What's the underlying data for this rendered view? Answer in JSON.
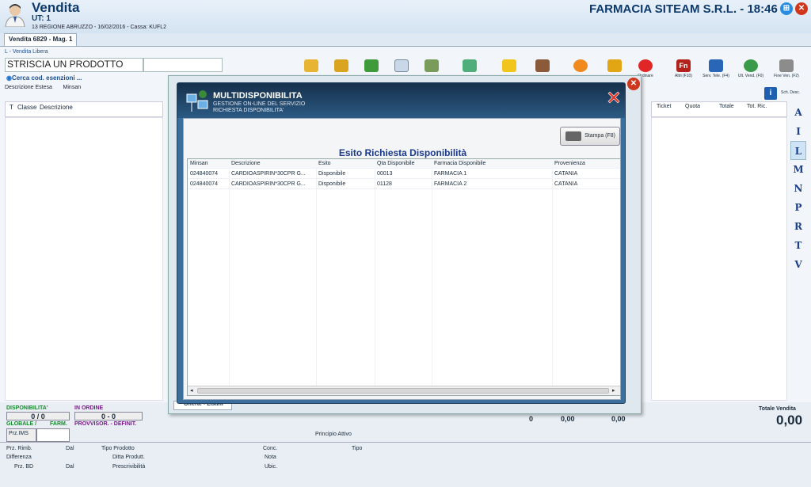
{
  "header": {
    "title": "Vendita",
    "user": "UT: 1",
    "info": "13 REGIONE ABRUZZO - 16/02/2016 - Cassa: KUFL2",
    "company": "FARMACIA SITEAM S.R.L. - 18:46"
  },
  "tab": {
    "label": "Vendita 6829 - Mag. 1"
  },
  "sale": {
    "type": "L - Vendita Libera",
    "product_placeholder": "STRISCIA UN PRODOTTO",
    "cerca": "Cerca cod. esenzioni ...",
    "col1": "Descrizione Estesa",
    "col2": "Minsan"
  },
  "table_headers": [
    "T",
    "Classe",
    "Descrizione"
  ],
  "right_headers": [
    "Ticket",
    "Quota",
    "Totale",
    "Tot. Ric."
  ],
  "toolbar": {
    "ordinare": "Ordinare",
    "altri": "Altri (F10)",
    "serv_tele": "Serv. Tele. (F4)",
    "ult_vend": "Ult. Vend. (F0)",
    "fine_ven": "Fine Ven. (F2)",
    "sch_desc": "Sch. Desc."
  },
  "letters": [
    "A",
    "I",
    "L",
    "M",
    "N",
    "P",
    "R",
    "T",
    "V"
  ],
  "dialog": {
    "title": "MULTIDISPONIBILITA",
    "sub1": "GESTIONE ON-LINE DEL SERVIZIO",
    "sub2": "RICHIESTA DISPONIBILITA'",
    "stampa": "Stampa (F8)",
    "esito": "Esito Richiesta Disponibilità",
    "headers": [
      "Minsan",
      "Descrizione",
      "Esito",
      "Qta Disponibile",
      "Farmacia Disponibile",
      "Provenienza"
    ],
    "rows": [
      [
        "024840074",
        "CARDIOASPIRIN*30CPR G...",
        "Disponibile",
        "00013",
        "FARMACIA 1",
        "CATANIA"
      ],
      [
        "024840074",
        "CARDIOASPIRIN*30CPR G...",
        "Disponibile",
        "01128",
        "FARMACIA 2",
        "CATANIA"
      ]
    ]
  },
  "offerte": "Offerte - Listini",
  "bottom": {
    "disp": "DISPONIBILITA'",
    "disp_val": "0 / 0",
    "ordine": "IN ORDINE",
    "ordine_val": "0 - 0",
    "globale": "GLOBALE /",
    "farm": "FARM.",
    "provv": "PROVVISOR. - DEFINIT.",
    "przims": "Prz.IMS",
    "principio": "Principio Attivo",
    "zero": "0",
    "v1": "0,00",
    "v2": "0,00",
    "totale_label": "Totale Vendita",
    "totale": "0,00",
    "przrimb": "Prz. Rimb.",
    "dal1": "Dal",
    "tipoprod": "Tipo Prodotto",
    "conc": "Conc.",
    "tipo": "Tipo",
    "diff": "Differenza",
    "ditta": "Ditta Produtt.",
    "nota": "Nota",
    "przbd": "Prz. BD",
    "dal2": "Dal",
    "prescr": "Prescrivibilità",
    "ubic": "Ubic."
  }
}
